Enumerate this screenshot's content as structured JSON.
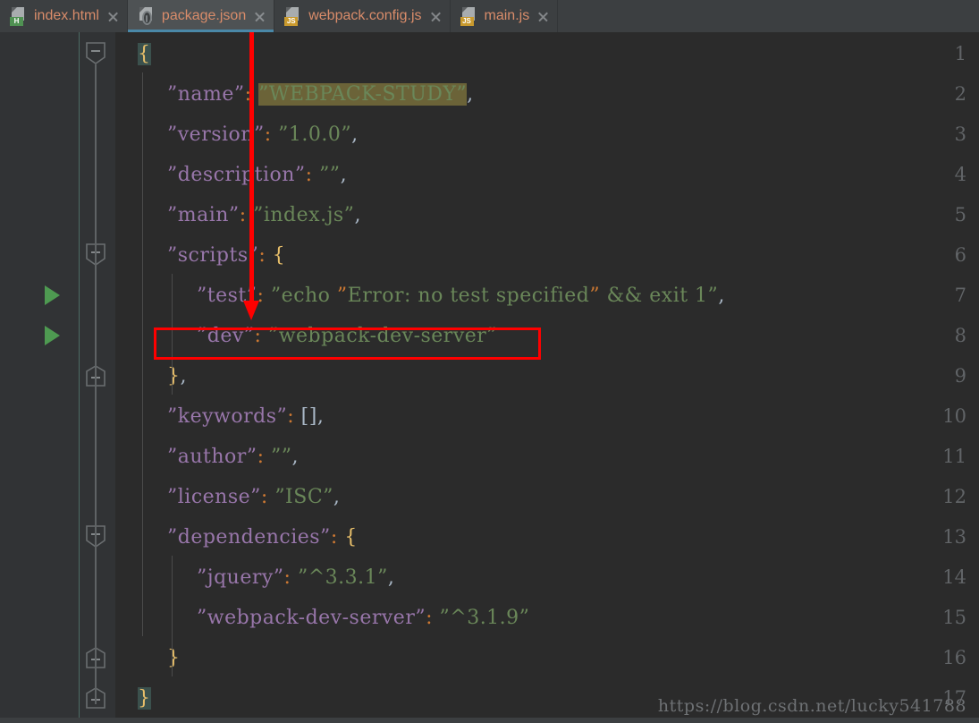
{
  "window": {
    "title": "package.json",
    "background": "#2b2b2b"
  },
  "colors": {
    "editor_background": "#2b2b2b",
    "gutter_background": "#313335",
    "tabbar_background": "#3c3f41",
    "active_tab_background": "#4e5254",
    "active_tab_underline": "#4a88a8",
    "tab_label": "#d98c6a",
    "key_violet": "#9876aa",
    "string_green": "#6a8759",
    "colon_orange": "#cc7832",
    "brace_yellow": "#e8bf6a",
    "punctuation": "#a9b7c6",
    "selection_highlight": "#6b6338",
    "matched_brace_highlight": "#3b514d",
    "run_arrow_green": "#4e9a51",
    "annotation_red": "#fe0000",
    "line_number": "#616467",
    "watermark": "#6e7174"
  },
  "tabs": [
    {
      "label": "index.html",
      "icon": "html-file-icon",
      "badge": "H",
      "badge_style": "badge-html",
      "active": false,
      "closable": true
    },
    {
      "label": "package.json",
      "icon": "json-file-icon",
      "badge": "",
      "badge_style": "",
      "active": true,
      "closable": true
    },
    {
      "label": "webpack.config.js",
      "icon": "js-file-icon",
      "badge": "JS",
      "badge_style": "badge-js",
      "active": false,
      "closable": true
    },
    {
      "label": "main.js",
      "icon": "js-file-icon",
      "badge": "JS",
      "badge_style": "badge-js",
      "active": false,
      "closable": true
    }
  ],
  "editor": {
    "language": "json",
    "line_numbers": [
      "1",
      "2",
      "3",
      "4",
      "5",
      "6",
      "7",
      "8",
      "9",
      "10",
      "11",
      "12",
      "13",
      "14",
      "15",
      "16",
      "17"
    ],
    "lines": [
      {
        "n": 1,
        "indent": 0,
        "text": "{"
      },
      {
        "n": 2,
        "indent": 1,
        "text": "\"name\": \"WEBPACK-STUDY\","
      },
      {
        "n": 3,
        "indent": 1,
        "text": "\"version\": \"1.0.0\","
      },
      {
        "n": 4,
        "indent": 1,
        "text": "\"description\": \"\","
      },
      {
        "n": 5,
        "indent": 1,
        "text": "\"main\": \"index.js\","
      },
      {
        "n": 6,
        "indent": 1,
        "text": "\"scripts\": {"
      },
      {
        "n": 7,
        "indent": 2,
        "text": "\"test\": \"echo \\\"Error: no test specified\\\" && exit 1\","
      },
      {
        "n": 8,
        "indent": 2,
        "text": "\"dev\": \"webpack-dev-server\""
      },
      {
        "n": 9,
        "indent": 1,
        "text": "},"
      },
      {
        "n": 10,
        "indent": 1,
        "text": "\"keywords\": [],"
      },
      {
        "n": 11,
        "indent": 1,
        "text": "\"author\": \"\","
      },
      {
        "n": 12,
        "indent": 1,
        "text": "\"license\": \"ISC\","
      },
      {
        "n": 13,
        "indent": 1,
        "text": "\"dependencies\": {"
      },
      {
        "n": 14,
        "indent": 2,
        "text": "\"jquery\": \"^3.3.1\","
      },
      {
        "n": 15,
        "indent": 2,
        "text": "\"webpack-dev-server\": \"^3.1.9\""
      },
      {
        "n": 16,
        "indent": 1,
        "text": "}"
      },
      {
        "n": 17,
        "indent": 0,
        "text": "}"
      }
    ],
    "fold_marker_lines": [
      1,
      6,
      9,
      13,
      16,
      17
    ],
    "run_gutter_lines": [
      7,
      8
    ],
    "selected_text": "\"WEBPACK-STUDY\"",
    "matched_brace_lines": [
      1,
      17
    ]
  },
  "annotations": {
    "arrow": {
      "label": "red-down-arrow",
      "points_to": "\"dev\": \"webpack-dev-server\""
    },
    "box": {
      "label": "red-highlight-box",
      "surrounds": "\"dev\": \"webpack-dev-server\""
    }
  },
  "watermark": {
    "text": "https://blog.csdn.net/lucky541788"
  }
}
